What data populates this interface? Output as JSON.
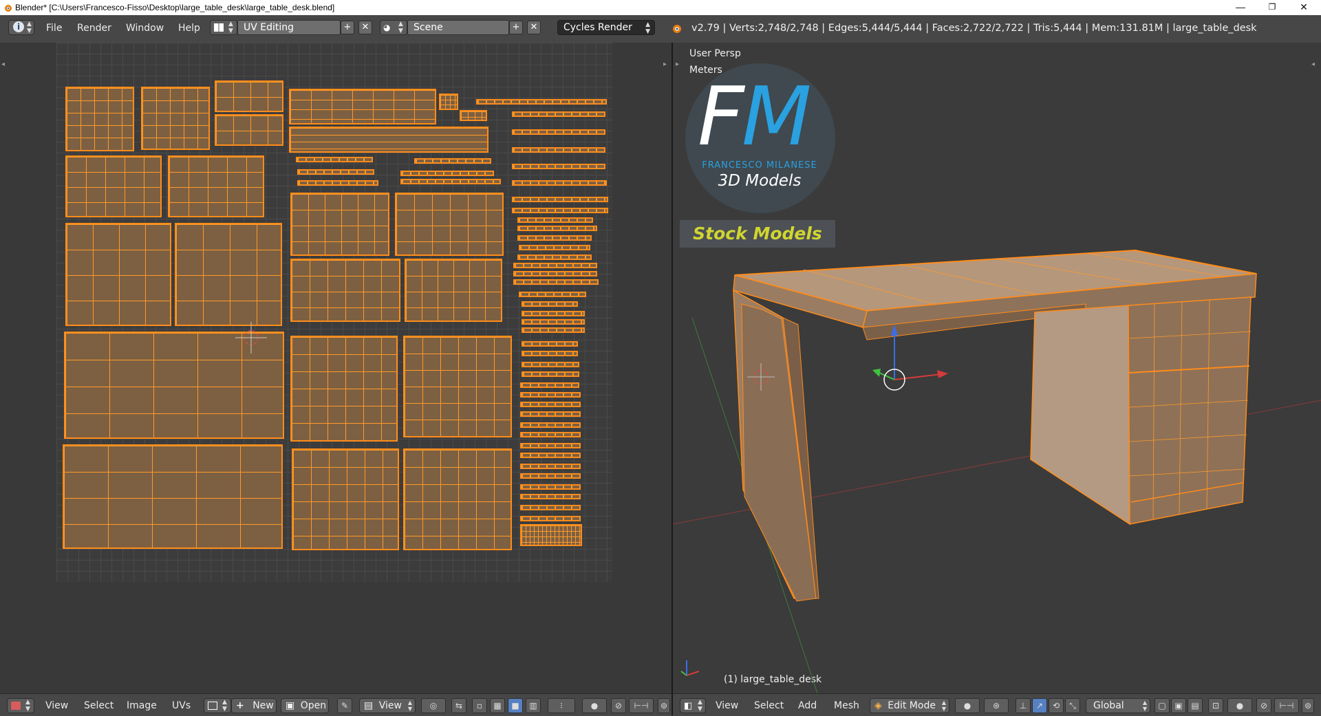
{
  "titlebar": {
    "title": "Blender* [C:\\Users\\Francesco-Fisso\\Desktop\\large_table_desk\\large_table_desk.blend]",
    "minimize": "—",
    "maximize": "❐",
    "close": "✕"
  },
  "header": {
    "info_icon": "i",
    "menus": [
      "File",
      "Render",
      "Window",
      "Help"
    ],
    "screen_layout": "UV Editing",
    "scene": "Scene",
    "render_engine": "Cycles Render",
    "stats": "v2.79 | Verts:2,748/2,748 | Edges:5,444/5,444 | Faces:2,722/2,722 | Tris:5,444 | Mem:131.81M | large_table_desk",
    "add_symbol": "+",
    "remove_symbol": "✕"
  },
  "view3d": {
    "view_name": "User Persp",
    "units": "Meters",
    "object_label": "(1) large_table_desk"
  },
  "logo": {
    "fm_f": "F",
    "fm_m": "M",
    "name": "FRANCESCO MILANESE",
    "tagline": "3D Models",
    "badge": "Stock Models"
  },
  "uv_footer": {
    "menus": [
      "View",
      "Select",
      "Image",
      "UVs"
    ],
    "new_label": "New",
    "open_label": "Open",
    "view_label": "View"
  },
  "view3d_footer": {
    "menus": [
      "View",
      "Select",
      "Add",
      "Mesh"
    ],
    "mode": "Edit Mode",
    "orientation": "Global"
  },
  "colors": {
    "accent_selection": "#ff8c1a",
    "island_fill": "#7d6041",
    "logo_blue": "#2aa1e0",
    "badge_text": "#d0d630",
    "active_button": "#5680c2"
  }
}
